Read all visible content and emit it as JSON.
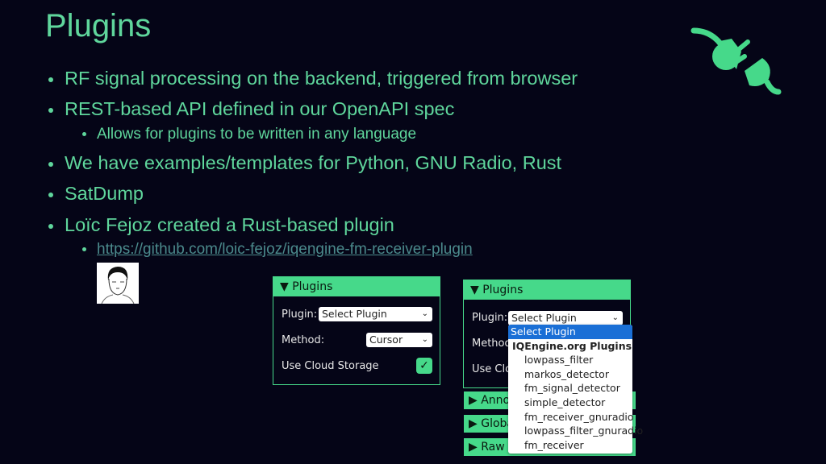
{
  "title": "Plugins",
  "bullets": [
    {
      "text": "RF signal processing on the backend, triggered from browser"
    },
    {
      "text": "REST-based API defined in our OpenAPI spec",
      "sub": "Allows for plugins to be written in any language"
    },
    {
      "text": "We have examples/templates for Python, GNU Radio, Rust"
    },
    {
      "text": "SatDump"
    },
    {
      "text": "Loïc Fejoz created a Rust-based plugin",
      "sub": "https://github.com/loic-fejoz/iqengine-fm-receiver-plugin"
    }
  ],
  "icons": {
    "logo": "plug-unplugged-icon",
    "avatar": "portrait-sketch"
  },
  "colors": {
    "background": "#050517",
    "accent": "#46d98a",
    "text": "#5fd69c",
    "link": "#4b8a8c"
  },
  "panel_left": {
    "header": "▼ Plugins",
    "plugin_label": "Plugin:",
    "plugin_value": "Select Plugin",
    "method_label": "Method:",
    "method_value": "Cursor",
    "cloud_label": "Use Cloud Storage",
    "cloud_checked": true
  },
  "panel_right": {
    "header": "▼ Plugins",
    "plugin_label": "Plugin:",
    "plugin_value": "Select Plugin",
    "method_label": "Method",
    "cloud_label": "Use Clou",
    "collapsed": [
      "▶ Anno",
      "▶ Globa",
      "▶ Raw I"
    ],
    "dropdown": {
      "selected": "Select Plugin",
      "group": "IQEngine.org Plugins",
      "options": [
        "lowpass_filter",
        "markos_detector",
        "fm_signal_detector",
        "simple_detector",
        "fm_receiver_gnuradio",
        "lowpass_filter_gnuradio",
        "fm_receiver"
      ]
    }
  }
}
